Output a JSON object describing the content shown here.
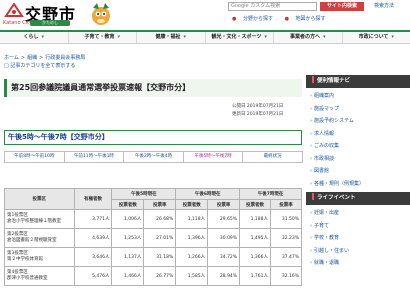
{
  "header": {
    "logo_text": "交野市",
    "logo_sub": "Katano City",
    "logo_kana": "かたのし",
    "search_placeholder": "Google カスタム検索",
    "search_button": "サイト内検索",
    "search_help": "検索方法",
    "util_links": [
      "分野から探す",
      "地図から探す"
    ]
  },
  "gnav": [
    "くらし",
    "子育て・教育",
    "健康・福祉",
    "観光・文化・スポーツ",
    "事業者の方へ",
    "市政について"
  ],
  "breadcrumb": [
    "ホーム",
    "組織",
    "行政委員会事務局"
  ],
  "category_link": "記事カテゴリを全て表示する",
  "page": {
    "title": "第25回参議院議員通常選挙投票速報【交野市分】",
    "published": "公開日 2019年07月21日",
    "updated": "更新日 2019年07月21日",
    "section_title": "午後5時〜午後7時【交野市分】"
  },
  "time_tabs": [
    {
      "label": "午前8時〜午前10時",
      "active": false
    },
    {
      "label": "午前11時〜午後1時",
      "active": false
    },
    {
      "label": "午後2時〜午後4時",
      "active": false
    },
    {
      "label": "午後5時〜午後7時",
      "active": true
    },
    {
      "label": "最終状況",
      "active": false
    }
  ],
  "table": {
    "h_district": "投票区",
    "h_voters": "有権者数",
    "groups": [
      "午後5時現在",
      "午後6時現在",
      "午後7時現在"
    ],
    "sub": [
      "投票者数",
      "投票率"
    ],
    "rows": [
      {
        "district": "第1投票区\n倉治小学校整理棟１階教室",
        "voters": "3,771人",
        "v5": "1,006人",
        "r5": "26.68%",
        "v6": "1,118人",
        "r6": "29.65%",
        "v7": "1,188人",
        "r7": "31.50%"
      },
      {
        "district": "第2投票区\n倉治図書館２階視聴覚室",
        "voters": "4,639人",
        "v5": "1,253人",
        "r5": "27.01%",
        "v6": "1,396人",
        "r6": "30.09%",
        "v7": "1,495人",
        "r7": "32.23%"
      },
      {
        "district": "第3投票区\n第２中学校体育館",
        "voters": "3,646人",
        "v5": "1,137人",
        "r5": "31.18%",
        "v6": "1,266人",
        "r6": "34.72%",
        "v7": "1,366人",
        "r7": "37.47%"
      },
      {
        "district": "第4投票区\n郡津小学校普通教室",
        "voters": "5,476人",
        "v5": "1,466人",
        "r5": "26.77%",
        "v6": "1,585人",
        "r6": "28.94%",
        "v7": "1,761人",
        "r7": "32.16%"
      }
    ]
  },
  "sidebar": {
    "nav_title": "便利情報ナビ",
    "nav_items": [
      "組織案内",
      "施設マップ",
      "施設予約システム",
      "求人情報",
      "ごみの収集",
      "市政相談",
      "図書館",
      "各種・規則（例規集）"
    ],
    "life_title": "ライフイベント",
    "life_items": [
      "妊娠・出産",
      "子育て",
      "学校・教育",
      "引越し・住まい",
      "就職・退職"
    ]
  }
}
